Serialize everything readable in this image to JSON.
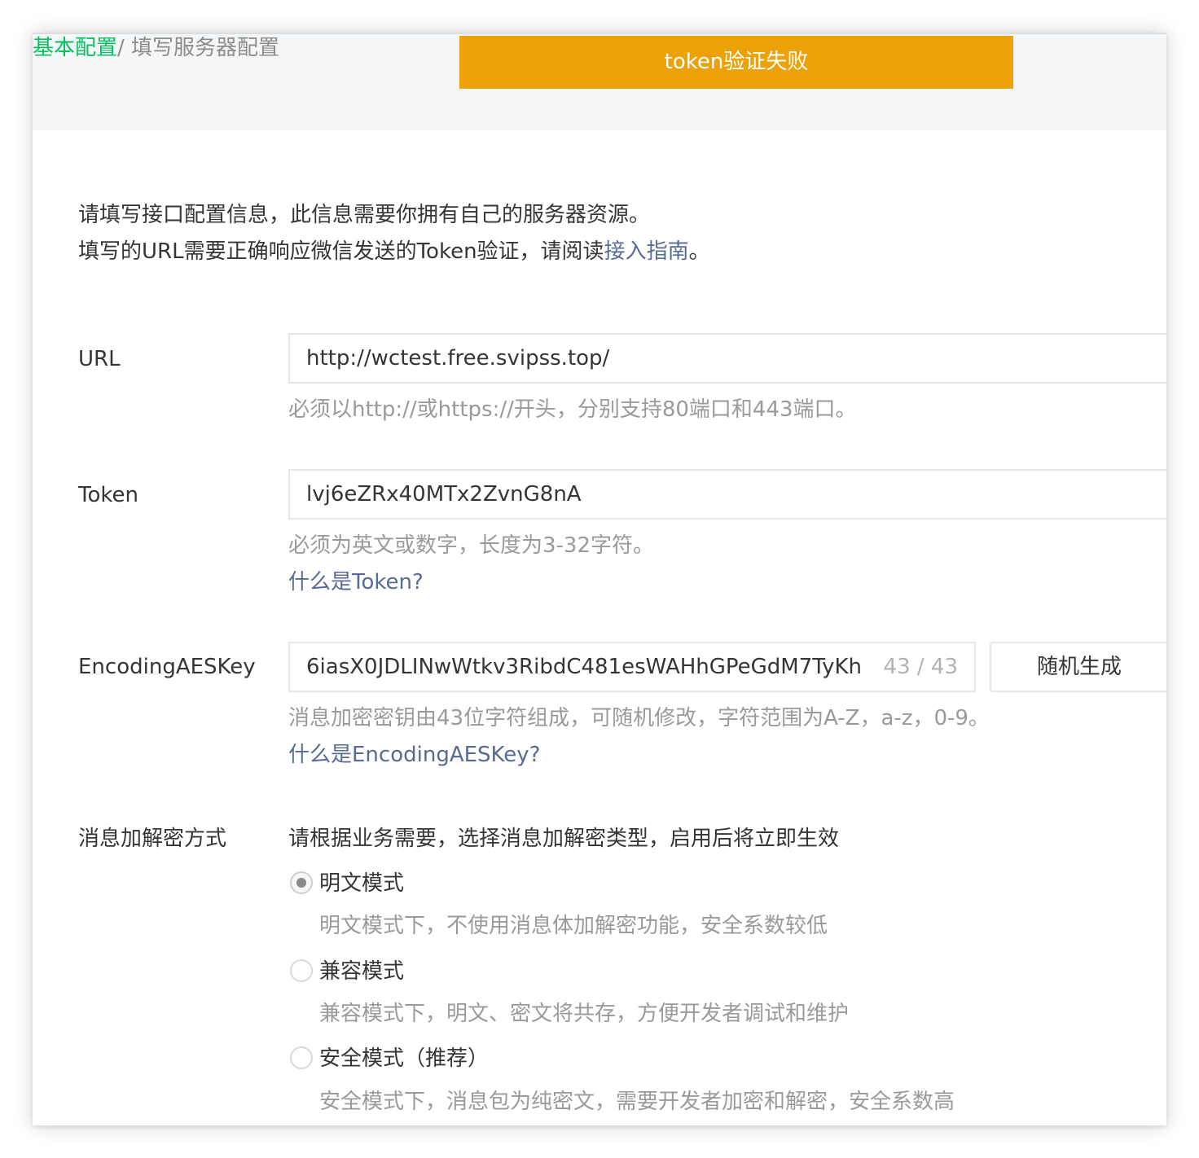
{
  "breadcrumb": {
    "root": "基本配置",
    "separator": "/ ",
    "current": "填写服务器配置"
  },
  "toast": {
    "message": "token验证失败"
  },
  "intro": {
    "line1": "请填写接口配置信息，此信息需要你拥有自己的服务器资源。",
    "line2_prefix": "填写的URL需要正确响应微信发送的Token验证，请阅读",
    "line2_link": "接入指南",
    "line2_suffix": "。"
  },
  "url_field": {
    "label": "URL",
    "value": "http://wctest.free.svipss.top/",
    "hint": "必须以http://或https://开头，分别支持80端口和443端口。"
  },
  "token_field": {
    "label": "Token",
    "value": "lvj6eZRx40MTx2ZvnG8nA",
    "hint": "必须为英文或数字，长度为3-32字符。",
    "help_link": "什么是Token?"
  },
  "aeskey_field": {
    "label": "EncodingAESKey",
    "value": "6iasX0JDLINwWtkv3RibdC481esWAHhGPeGdM7TyKh",
    "counter": "43 / 43",
    "generate_button": "随机生成",
    "hint": "消息加密密钥由43位字符组成，可随机修改，字符范围为A-Z，a-z，0-9。",
    "help_link": "什么是EncodingAESKey?"
  },
  "encryption": {
    "label": "消息加解密方式",
    "description": "请根据业务需要，选择消息加解密类型，启用后将立即生效",
    "options": [
      {
        "label": "明文模式",
        "desc": "明文模式下，不使用消息体加解密功能，安全系数较低",
        "selected": true
      },
      {
        "label": "兼容模式",
        "desc": "兼容模式下，明文、密文将共存，方便开发者调试和维护",
        "selected": false
      },
      {
        "label": "安全模式（推荐）",
        "desc": "安全模式下，消息包为纯密文，需要开发者加密和解密，安全系数高",
        "selected": false
      }
    ]
  },
  "colors": {
    "toast_bg": "#eca106",
    "breadcrumb_link": "#07c160",
    "link": "#576b95",
    "hint_text": "#9a9a9a"
  }
}
